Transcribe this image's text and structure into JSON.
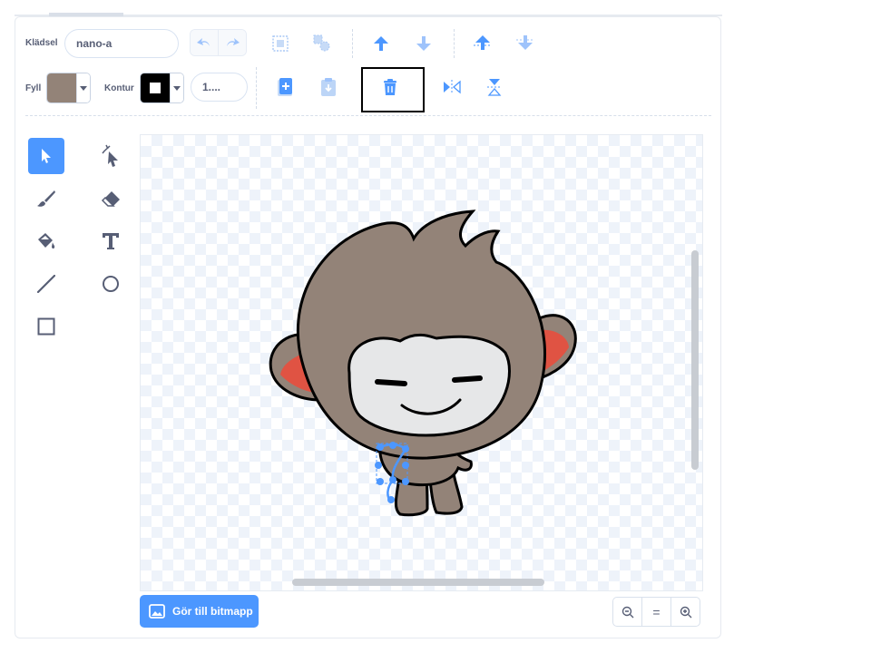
{
  "costume": {
    "label": "Klädsel",
    "name": "nano-a"
  },
  "fill": {
    "label": "Fyll",
    "color": "#938378"
  },
  "outline": {
    "label": "Kontur",
    "color": "#000000",
    "width": "1...."
  },
  "toolbar": {
    "undo": "undo-icon",
    "redo": "redo-icon",
    "group": "group-icon",
    "ungroup": "ungroup-icon",
    "forward": "forward-icon",
    "backward": "backward-icon",
    "front": "front-icon",
    "back": "back-icon",
    "copy": "copy-icon",
    "paste": "paste-icon",
    "delete": "delete-icon",
    "flip_h": "flip-horizontal-icon",
    "flip_v": "flip-vertical-icon"
  },
  "tools": [
    "select",
    "reshape",
    "brush",
    "eraser",
    "fill",
    "text",
    "line",
    "circle",
    "rectangle"
  ],
  "active_tool": "select",
  "convert_button": {
    "label": "Gör till bitmapp"
  },
  "zoom": {
    "out": "⊖",
    "reset": "=",
    "in": "⊕"
  },
  "colors": {
    "accent": "#4c97ff",
    "text": "#575e75"
  }
}
